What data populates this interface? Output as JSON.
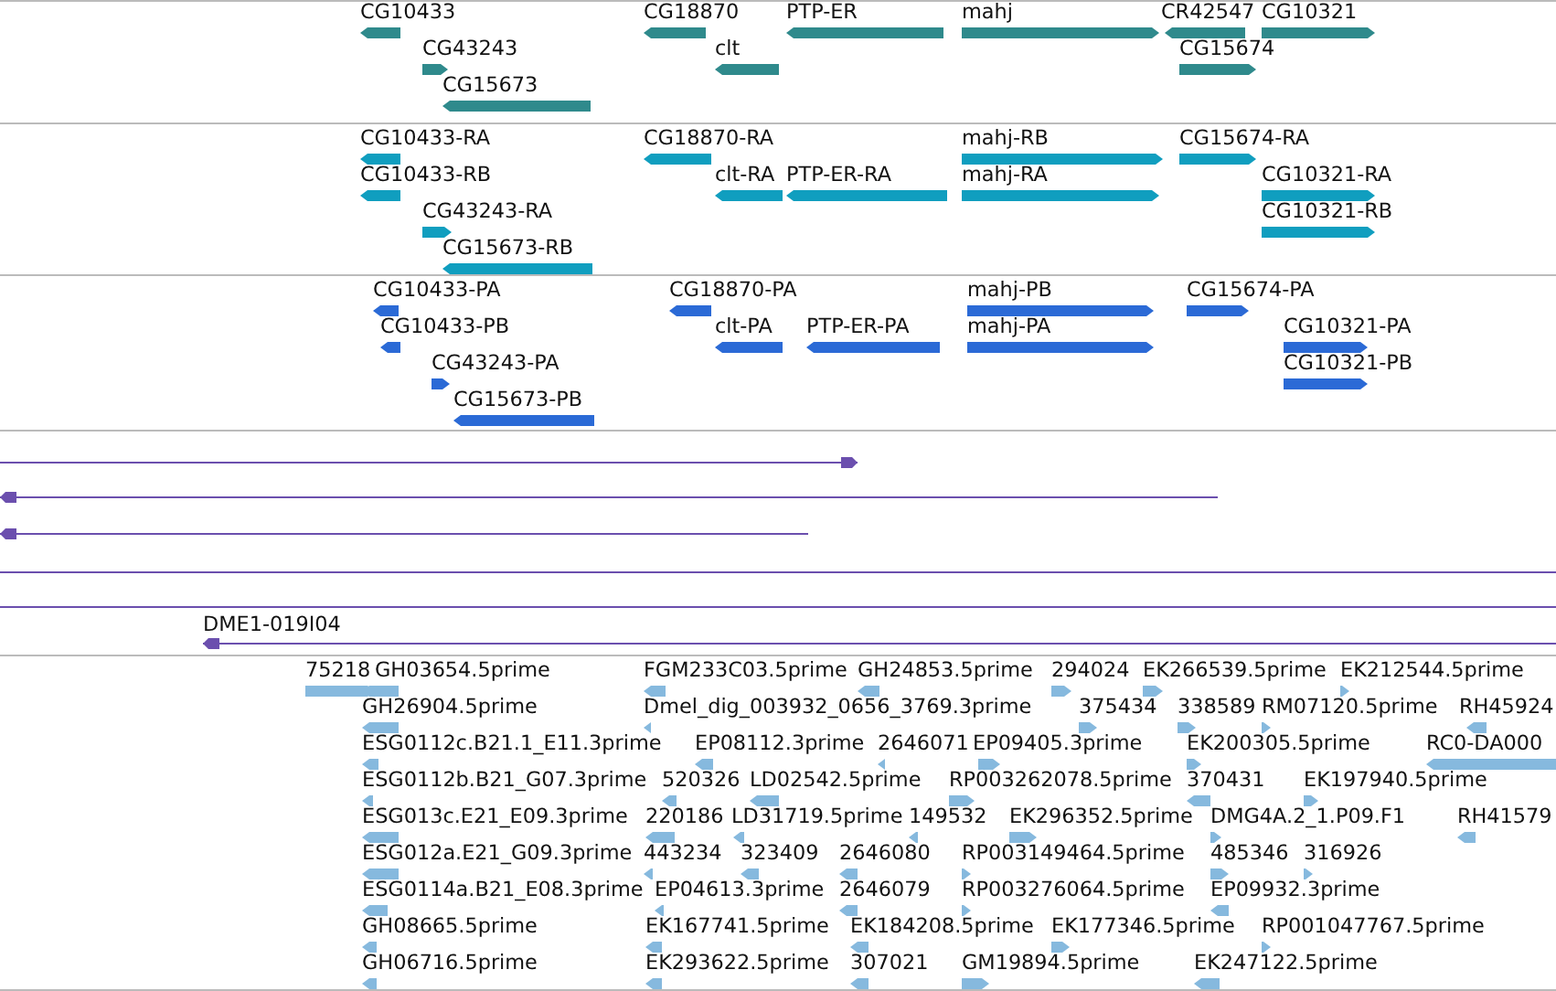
{
  "tracks": [
    {
      "kind": "genes",
      "features": [
        {
          "label": "CG10433",
          "reverse": true
        },
        {
          "label": "CG43243",
          "reverse": false
        },
        {
          "label": "CG15673",
          "reverse": true
        },
        {
          "label": "CG18870",
          "reverse": true
        },
        {
          "label": "clt",
          "reverse": true
        },
        {
          "label": "PTP-ER",
          "reverse": true
        },
        {
          "label": "mahj",
          "reverse": false
        },
        {
          "label": "CR42547",
          "reverse": true
        },
        {
          "label": "CG10321",
          "reverse": false
        },
        {
          "label": "CG15674",
          "reverse": false
        }
      ]
    },
    {
      "kind": "transcripts",
      "features": [
        {
          "label": "CG10433-RA",
          "reverse": true
        },
        {
          "label": "CG10433-RB",
          "reverse": true
        },
        {
          "label": "CG43243-RA",
          "reverse": false
        },
        {
          "label": "CG15673-RB",
          "reverse": true
        },
        {
          "label": "CG18870-RA",
          "reverse": true
        },
        {
          "label": "clt-RA",
          "reverse": true
        },
        {
          "label": "PTP-ER-RA",
          "reverse": true
        },
        {
          "label": "mahj-RB",
          "reverse": false
        },
        {
          "label": "mahj-RA",
          "reverse": false
        },
        {
          "label": "CG15674-RA",
          "reverse": false
        },
        {
          "label": "CG10321-RA",
          "reverse": false
        },
        {
          "label": "CG10321-RB",
          "reverse": false
        }
      ]
    },
    {
      "kind": "proteins",
      "features": [
        {
          "label": "CG10433-PA",
          "reverse": true
        },
        {
          "label": "CG10433-PB",
          "reverse": true
        },
        {
          "label": "CG43243-PA",
          "reverse": false
        },
        {
          "label": "CG15673-PB",
          "reverse": true
        },
        {
          "label": "CG18870-PA",
          "reverse": true
        },
        {
          "label": "clt-PA",
          "reverse": true
        },
        {
          "label": "PTP-ER-PA",
          "reverse": true
        },
        {
          "label": "mahj-PB",
          "reverse": false
        },
        {
          "label": "mahj-PA",
          "reverse": false
        },
        {
          "label": "CG15674-PA",
          "reverse": false
        },
        {
          "label": "CG10321-PA",
          "reverse": false
        },
        {
          "label": "CG10321-PB",
          "reverse": false
        }
      ]
    },
    {
      "kind": "alignments",
      "features": [
        {
          "kind": "arrow",
          "reverse": false
        },
        {
          "kind": "arrow",
          "reverse": true
        },
        {
          "kind": "arrow",
          "reverse": true
        },
        {
          "kind": "line"
        },
        {
          "kind": "line"
        },
        {
          "kind": "arrow",
          "label": "DME1-019I04",
          "reverse": true
        }
      ]
    },
    {
      "kind": "ests",
      "features": [
        {
          "label": "75218",
          "reverse": false
        },
        {
          "label": "GH03654.5prime",
          "reverse": true
        },
        {
          "label": "FGM233C03.5prime",
          "reverse": true
        },
        {
          "label": "GH24853.5prime",
          "reverse": true
        },
        {
          "label": "294024",
          "reverse": false
        },
        {
          "label": "EK266539.5prime",
          "reverse": false
        },
        {
          "label": "EK212544.5prime",
          "reverse": false
        },
        {
          "label": "GH26904.5prime",
          "reverse": true
        },
        {
          "label": "Dmel_dig_003932_0656_3769.3prime",
          "reverse": true
        },
        {
          "label": "375434",
          "reverse": false
        },
        {
          "label": "338589",
          "reverse": false
        },
        {
          "label": "RM07120.5prime",
          "reverse": false
        },
        {
          "label": "RH45924",
          "reverse": true
        },
        {
          "label": "ESG0112c.B21.1_E11.3prime",
          "reverse": true
        },
        {
          "label": "EP08112.3prime",
          "reverse": true
        },
        {
          "label": "2646071",
          "reverse": true
        },
        {
          "label": "EP09405.3prime",
          "reverse": false
        },
        {
          "label": "EK200305.5prime",
          "reverse": false
        },
        {
          "label": "RC0-DA000",
          "reverse": true
        },
        {
          "label": "ESG0112b.B21_G07.3prime",
          "reverse": true
        },
        {
          "label": "520326",
          "reverse": true
        },
        {
          "label": "LD02542.5prime",
          "reverse": true
        },
        {
          "label": "RP003262078.5prime",
          "reverse": false
        },
        {
          "label": "370431",
          "reverse": true
        },
        {
          "label": "EK197940.5prime",
          "reverse": false
        },
        {
          "label": "ESG013c.E21_E09.3prime",
          "reverse": true
        },
        {
          "label": "220186",
          "reverse": true
        },
        {
          "label": "LD31719.5prime",
          "reverse": true
        },
        {
          "label": "149532",
          "reverse": true
        },
        {
          "label": "EK296352.5prime",
          "reverse": false
        },
        {
          "label": "DMG4A.2_1.P09.F1",
          "reverse": false
        },
        {
          "label": "RH41579",
          "reverse": true
        },
        {
          "label": "ESG012a.E21_G09.3prime",
          "reverse": true
        },
        {
          "label": "443234",
          "reverse": true
        },
        {
          "label": "323409",
          "reverse": true
        },
        {
          "label": "2646080",
          "reverse": true
        },
        {
          "label": "RP003149464.5prime",
          "reverse": false
        },
        {
          "label": "485346",
          "reverse": false
        },
        {
          "label": "316926",
          "reverse": false
        },
        {
          "label": "ESG0114a.B21_E08.3prime",
          "reverse": true
        },
        {
          "label": "EP04613.3prime",
          "reverse": true
        },
        {
          "label": "2646079",
          "reverse": true
        },
        {
          "label": "RP003276064.5prime",
          "reverse": false
        },
        {
          "label": "EP09932.3prime",
          "reverse": true
        },
        {
          "label": "GH08665.5prime",
          "reverse": true
        },
        {
          "label": "EK167741.5prime",
          "reverse": true
        },
        {
          "label": "EK184208.5prime",
          "reverse": true
        },
        {
          "label": "EK177346.5prime",
          "reverse": false
        },
        {
          "label": "RP001047767.5prime",
          "reverse": false
        },
        {
          "label": "GH06716.5prime",
          "reverse": true
        },
        {
          "label": "EK293622.5prime",
          "reverse": true
        },
        {
          "label": "307021",
          "reverse": true
        },
        {
          "label": "GM19894.5prime",
          "reverse": false
        },
        {
          "label": "EK247122.5prime",
          "reverse": true
        }
      ]
    }
  ]
}
